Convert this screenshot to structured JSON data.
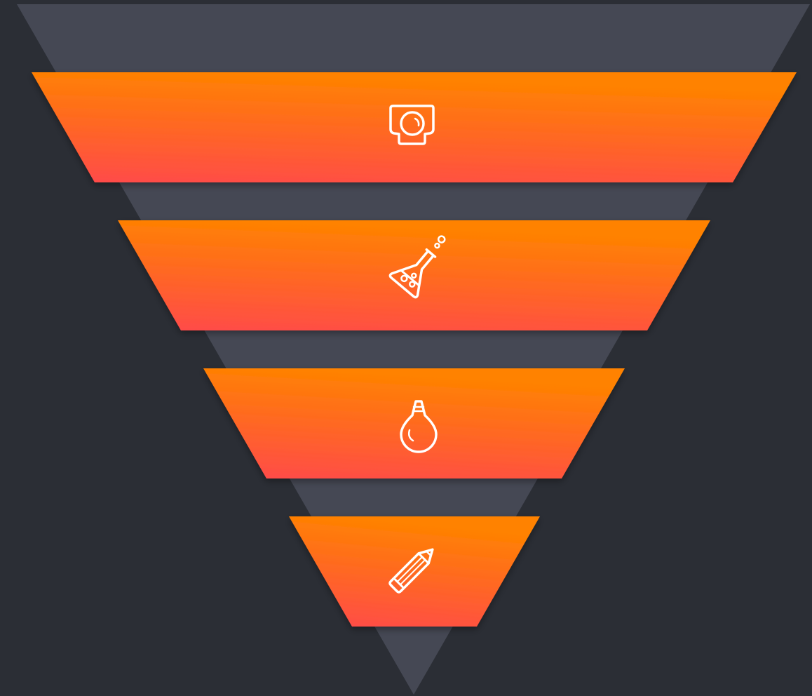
{
  "diagram": {
    "type": "inverted-funnel",
    "background_color": "#2b2e35",
    "backdrop_color": "#454854",
    "gradient_top_color": "#ff8200",
    "gradient_bottom_color": "#ff4a4a",
    "icon_color": "#ffffff",
    "stages": [
      {
        "icon": "camera-lens-icon"
      },
      {
        "icon": "flask-icon"
      },
      {
        "icon": "lightbulb-icon"
      },
      {
        "icon": "pencil-icon"
      }
    ]
  }
}
